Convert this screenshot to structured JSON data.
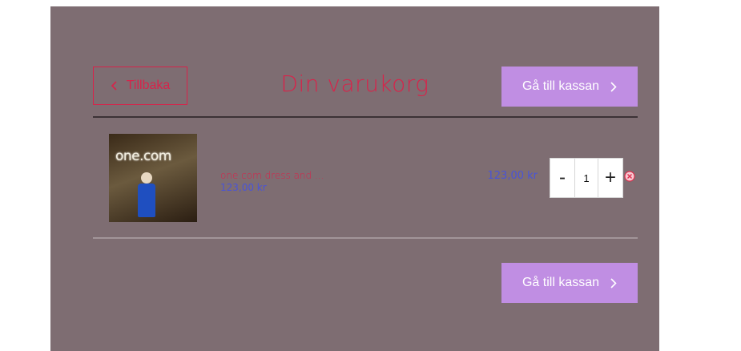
{
  "cart": {
    "back_label": "Tillbaka",
    "title": "Din varukorg",
    "checkout_label": "Gå till kassan",
    "item": {
      "thumbnail_text": "one.com",
      "name": "one.com dress and ...",
      "unit_price": "123,00 kr",
      "line_total": "123,00 kr",
      "quantity": "1",
      "decrement_label": "-",
      "increment_label": "+"
    }
  },
  "icons": {
    "back": "chevron-left-icon",
    "checkout": "chevron-right-icon",
    "remove": "remove-circle-icon"
  },
  "colors": {
    "background": "#7e6d72",
    "accent_red": "#d8234a",
    "accent_blue": "#4a54d6",
    "button_purple": "#c08ee3"
  }
}
